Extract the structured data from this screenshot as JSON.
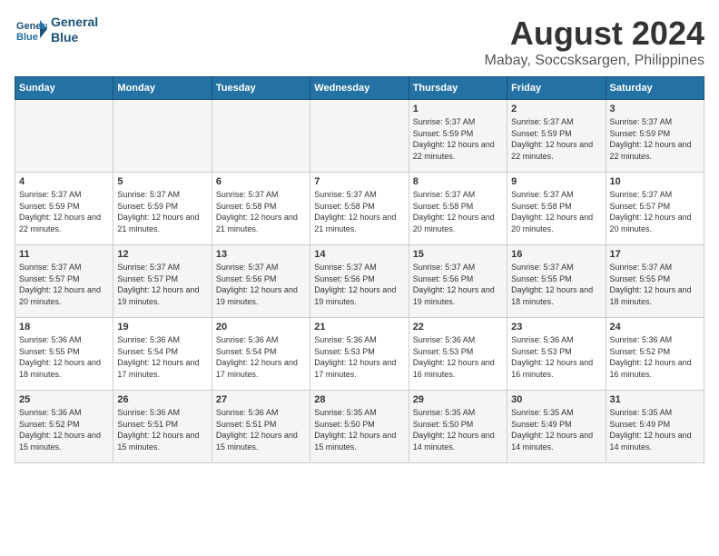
{
  "header": {
    "logo_line1": "General",
    "logo_line2": "Blue",
    "month": "August 2024",
    "location": "Mabay, Soccsksargen, Philippines"
  },
  "weekdays": [
    "Sunday",
    "Monday",
    "Tuesday",
    "Wednesday",
    "Thursday",
    "Friday",
    "Saturday"
  ],
  "weeks": [
    [
      {
        "day": "",
        "info": ""
      },
      {
        "day": "",
        "info": ""
      },
      {
        "day": "",
        "info": ""
      },
      {
        "day": "",
        "info": ""
      },
      {
        "day": "1",
        "info": "Sunrise: 5:37 AM\nSunset: 5:59 PM\nDaylight: 12 hours\nand 22 minutes."
      },
      {
        "day": "2",
        "info": "Sunrise: 5:37 AM\nSunset: 5:59 PM\nDaylight: 12 hours\nand 22 minutes."
      },
      {
        "day": "3",
        "info": "Sunrise: 5:37 AM\nSunset: 5:59 PM\nDaylight: 12 hours\nand 22 minutes."
      }
    ],
    [
      {
        "day": "4",
        "info": "Sunrise: 5:37 AM\nSunset: 5:59 PM\nDaylight: 12 hours\nand 22 minutes."
      },
      {
        "day": "5",
        "info": "Sunrise: 5:37 AM\nSunset: 5:59 PM\nDaylight: 12 hours\nand 21 minutes."
      },
      {
        "day": "6",
        "info": "Sunrise: 5:37 AM\nSunset: 5:58 PM\nDaylight: 12 hours\nand 21 minutes."
      },
      {
        "day": "7",
        "info": "Sunrise: 5:37 AM\nSunset: 5:58 PM\nDaylight: 12 hours\nand 21 minutes."
      },
      {
        "day": "8",
        "info": "Sunrise: 5:37 AM\nSunset: 5:58 PM\nDaylight: 12 hours\nand 20 minutes."
      },
      {
        "day": "9",
        "info": "Sunrise: 5:37 AM\nSunset: 5:58 PM\nDaylight: 12 hours\nand 20 minutes."
      },
      {
        "day": "10",
        "info": "Sunrise: 5:37 AM\nSunset: 5:57 PM\nDaylight: 12 hours\nand 20 minutes."
      }
    ],
    [
      {
        "day": "11",
        "info": "Sunrise: 5:37 AM\nSunset: 5:57 PM\nDaylight: 12 hours\nand 20 minutes."
      },
      {
        "day": "12",
        "info": "Sunrise: 5:37 AM\nSunset: 5:57 PM\nDaylight: 12 hours\nand 19 minutes."
      },
      {
        "day": "13",
        "info": "Sunrise: 5:37 AM\nSunset: 5:56 PM\nDaylight: 12 hours\nand 19 minutes."
      },
      {
        "day": "14",
        "info": "Sunrise: 5:37 AM\nSunset: 5:56 PM\nDaylight: 12 hours\nand 19 minutes."
      },
      {
        "day": "15",
        "info": "Sunrise: 5:37 AM\nSunset: 5:56 PM\nDaylight: 12 hours\nand 19 minutes."
      },
      {
        "day": "16",
        "info": "Sunrise: 5:37 AM\nSunset: 5:55 PM\nDaylight: 12 hours\nand 18 minutes."
      },
      {
        "day": "17",
        "info": "Sunrise: 5:37 AM\nSunset: 5:55 PM\nDaylight: 12 hours\nand 18 minutes."
      }
    ],
    [
      {
        "day": "18",
        "info": "Sunrise: 5:36 AM\nSunset: 5:55 PM\nDaylight: 12 hours\nand 18 minutes."
      },
      {
        "day": "19",
        "info": "Sunrise: 5:36 AM\nSunset: 5:54 PM\nDaylight: 12 hours\nand 17 minutes."
      },
      {
        "day": "20",
        "info": "Sunrise: 5:36 AM\nSunset: 5:54 PM\nDaylight: 12 hours\nand 17 minutes."
      },
      {
        "day": "21",
        "info": "Sunrise: 5:36 AM\nSunset: 5:53 PM\nDaylight: 12 hours\nand 17 minutes."
      },
      {
        "day": "22",
        "info": "Sunrise: 5:36 AM\nSunset: 5:53 PM\nDaylight: 12 hours\nand 16 minutes."
      },
      {
        "day": "23",
        "info": "Sunrise: 5:36 AM\nSunset: 5:53 PM\nDaylight: 12 hours\nand 16 minutes."
      },
      {
        "day": "24",
        "info": "Sunrise: 5:36 AM\nSunset: 5:52 PM\nDaylight: 12 hours\nand 16 minutes."
      }
    ],
    [
      {
        "day": "25",
        "info": "Sunrise: 5:36 AM\nSunset: 5:52 PM\nDaylight: 12 hours\nand 15 minutes."
      },
      {
        "day": "26",
        "info": "Sunrise: 5:36 AM\nSunset: 5:51 PM\nDaylight: 12 hours\nand 15 minutes."
      },
      {
        "day": "27",
        "info": "Sunrise: 5:36 AM\nSunset: 5:51 PM\nDaylight: 12 hours\nand 15 minutes."
      },
      {
        "day": "28",
        "info": "Sunrise: 5:35 AM\nSunset: 5:50 PM\nDaylight: 12 hours\nand 15 minutes."
      },
      {
        "day": "29",
        "info": "Sunrise: 5:35 AM\nSunset: 5:50 PM\nDaylight: 12 hours\nand 14 minutes."
      },
      {
        "day": "30",
        "info": "Sunrise: 5:35 AM\nSunset: 5:49 PM\nDaylight: 12 hours\nand 14 minutes."
      },
      {
        "day": "31",
        "info": "Sunrise: 5:35 AM\nSunset: 5:49 PM\nDaylight: 12 hours\nand 14 minutes."
      }
    ]
  ]
}
